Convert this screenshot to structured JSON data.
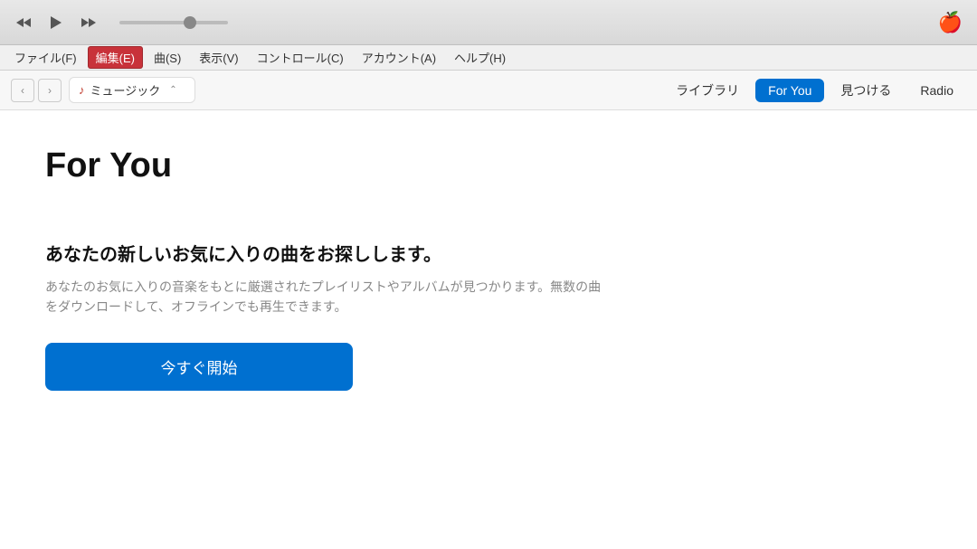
{
  "titleBar": {
    "appleLogo": "🍎"
  },
  "menuBar": {
    "items": [
      {
        "id": "file",
        "label": "ファイル(F)",
        "active": false
      },
      {
        "id": "edit",
        "label": "編集(E)",
        "active": true
      },
      {
        "id": "song",
        "label": "曲(S)",
        "active": false
      },
      {
        "id": "view",
        "label": "表示(V)",
        "active": false
      },
      {
        "id": "controls",
        "label": "コントロール(C)",
        "active": false
      },
      {
        "id": "account",
        "label": "アカウント(A)",
        "active": false
      },
      {
        "id": "help",
        "label": "ヘルプ(H)",
        "active": false
      }
    ]
  },
  "navBar": {
    "locationIcon": "♪",
    "locationText": "ミュージック",
    "tabs": [
      {
        "id": "library",
        "label": "ライブラリ",
        "active": false
      },
      {
        "id": "foryou",
        "label": "For You",
        "active": true
      },
      {
        "id": "discover",
        "label": "見つける",
        "active": false
      },
      {
        "id": "radio",
        "label": "Radio",
        "active": false
      }
    ],
    "backArrow": "‹",
    "forwardArrow": "›",
    "dropdownArrow": "⌃"
  },
  "mainContent": {
    "pageTitle": "For You",
    "promoHeading": "あなたの新しいお気に入りの曲をお探しします。",
    "promoDescription": "あなたのお気に入りの音楽をもとに厳選されたプレイリストやアルバムが見つかります。無数の曲をダウンロードして、オフラインでも再生できます。",
    "startButtonLabel": "今すぐ開始"
  },
  "colors": {
    "activeTab": "#0070d0",
    "activeMenu": "#c8323a",
    "startButton": "#0070d0"
  }
}
